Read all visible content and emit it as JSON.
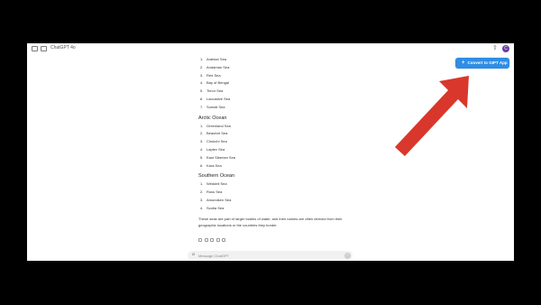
{
  "app": {
    "title": "ChatGPT 4o",
    "avatar_initial": "C"
  },
  "header": {
    "convert_button": "Convert to GIPT App"
  },
  "content": {
    "list_top": [
      {
        "n": "1.",
        "name": "Arabian Sea"
      },
      {
        "n": "2.",
        "name": "Andaman Sea"
      },
      {
        "n": "3.",
        "name": "Red Sea"
      },
      {
        "n": "4.",
        "name": "Bay of Bengal"
      },
      {
        "n": "5.",
        "name": "Timor Sea"
      },
      {
        "n": "6.",
        "name": "Laccadive Sea"
      },
      {
        "n": "7.",
        "name": "Somali Sea"
      }
    ],
    "arctic": {
      "heading": "Arctic Ocean",
      "items": [
        {
          "n": "1.",
          "name": "Greenland Sea"
        },
        {
          "n": "2.",
          "name": "Beaufort Sea"
        },
        {
          "n": "3.",
          "name": "Chukchi Sea"
        },
        {
          "n": "4.",
          "name": "Laptev Sea"
        },
        {
          "n": "5.",
          "name": "East Siberian Sea"
        },
        {
          "n": "6.",
          "name": "Kara Sea"
        }
      ]
    },
    "southern": {
      "heading": "Southern Ocean",
      "items": [
        {
          "n": "1.",
          "name": "Weddell Sea"
        },
        {
          "n": "2.",
          "name": "Ross Sea"
        },
        {
          "n": "3.",
          "name": "Amundsen Sea"
        },
        {
          "n": "4.",
          "name": "Scotia Sea"
        }
      ]
    },
    "summary": "These seas are part of larger bodies of water, and their names are often derived from their geographic locations or the countries they border."
  },
  "composer": {
    "placeholder": "Message ChatGPT"
  },
  "colors": {
    "button": "#2f8de4",
    "arrow": "#d9372b",
    "avatar": "#6b3fa0"
  },
  "icons": {
    "sidebar": "sidebar-toggle-icon",
    "new_chat": "new-chat-icon",
    "share": "share-icon",
    "attach": "paperclip-icon",
    "send": "send-arrow-icon"
  }
}
